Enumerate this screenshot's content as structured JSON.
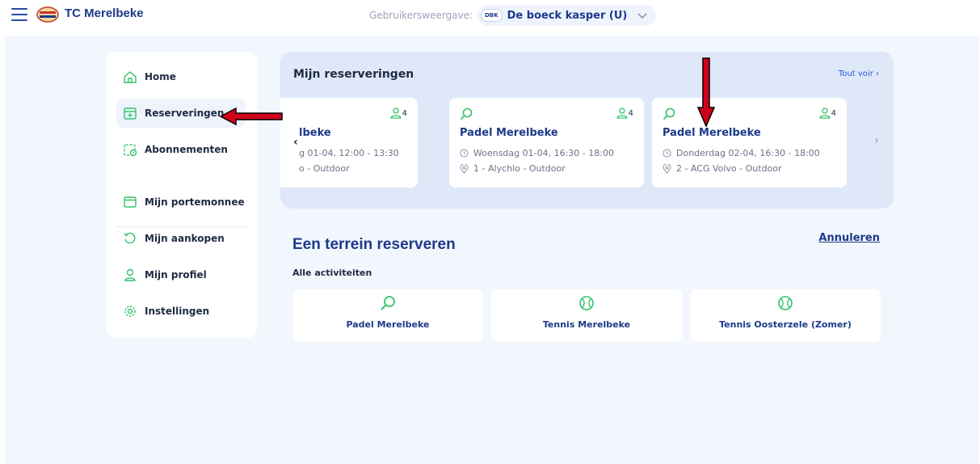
{
  "header": {
    "app_title": "TC Merelbeke",
    "viewer_label": "Gebruikersweergave:",
    "viewer_badge": "DBK",
    "viewer_name": "De boeck kasper (U)"
  },
  "sidebar": {
    "items": [
      {
        "label": "Home",
        "icon": "home-icon"
      },
      {
        "label": "Reserveringen",
        "icon": "calendar-plus-icon",
        "active": true
      },
      {
        "label": "Abonnementen",
        "icon": "subscription-icon"
      },
      {
        "label": "Mijn portemonnee",
        "icon": "wallet-icon"
      },
      {
        "label": "Mijn aankopen",
        "icon": "history-icon"
      },
      {
        "label": "Mijn profiel",
        "icon": "user-icon"
      },
      {
        "label": "Instellingen",
        "icon": "gear-icon"
      }
    ]
  },
  "reservations": {
    "title": "Mijn reserveringen",
    "see_all": "Tout voir",
    "cards": [
      {
        "name": "lbeke",
        "time": "g 01-04, 12:00 - 13:30",
        "court": "o - Outdoor",
        "count": "4"
      },
      {
        "name": "Padel Merelbeke",
        "time": "Woensdag 01-04, 16:30 - 18:00",
        "court": "1 - Alychlo - Outdoor",
        "count": "4"
      },
      {
        "name": "Padel Merelbeke",
        "time": "Donderdag 02-04, 16:30 - 18:00",
        "court": "2 - ACG Volvo - Outdoor",
        "count": "4"
      }
    ]
  },
  "booking": {
    "title": "Een terrein reserveren",
    "cancel": "Annuleren",
    "subtitle": "Alle activiteiten",
    "activities": [
      {
        "label": "Padel Merelbeke",
        "icon": "padel-racket-icon"
      },
      {
        "label": "Tennis Merelbeke",
        "icon": "tennis-ball-icon"
      },
      {
        "label": "Tennis Oosterzele (Zomer)",
        "icon": "tennis-ball-icon"
      }
    ]
  },
  "colors": {
    "accent": "#1d3a8a",
    "icon_green": "#33c26a",
    "annotation_arrow": "#d0021b"
  }
}
